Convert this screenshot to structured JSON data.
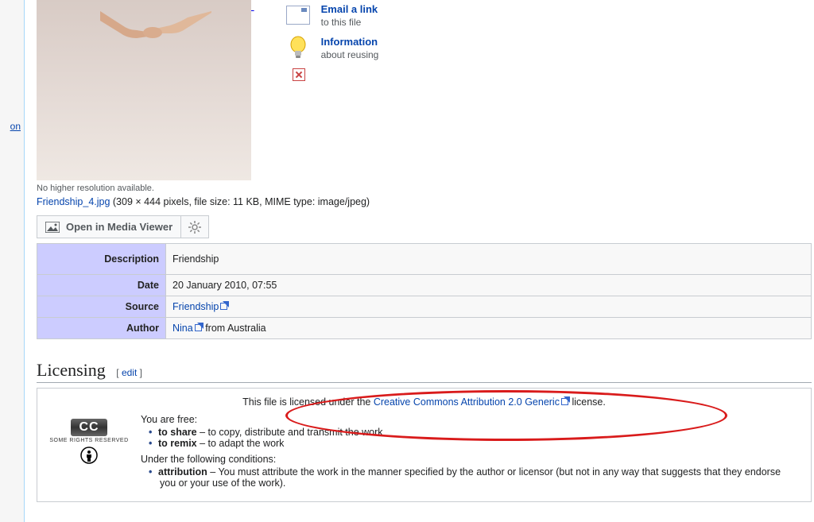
{
  "sidebar": {
    "truncated_link": "on"
  },
  "actions": {
    "email_label": "Email a link",
    "email_sub": "to this file",
    "info_label": "Information",
    "info_sub": "about reusing"
  },
  "file": {
    "no_higher": "No higher resolution available.",
    "filename": "Friendship_4.jpg",
    "details": " (309 × 444 pixels, file size: 11 KB, MIME type: image/jpeg)",
    "open_mv": "Open in Media Viewer"
  },
  "info_table": {
    "desc_label": "Description",
    "desc_value": "Friendship",
    "date_label": "Date",
    "date_value": "20 January 2010, 07:55",
    "source_label": "Source",
    "source_link": "Friendship",
    "author_label": "Author",
    "author_link": "Nina",
    "author_rest": " from Australia"
  },
  "licensing": {
    "heading": "Licensing",
    "edit_open": "[ ",
    "edit_label": "edit",
    "edit_close": " ]",
    "statement_pre": "This file is licensed under the ",
    "statement_link": "Creative Commons Attribution 2.0 Generic",
    "statement_post": " license.",
    "cc_logo": "CC",
    "some_rights": "SOME RIGHTS RESERVED",
    "you_are_free": "You are free:",
    "share_b": "to share",
    "share_rest": " – to copy, distribute and transmit the work",
    "remix_b": "to remix",
    "remix_rest": " – to adapt the work",
    "under_cond": "Under the following conditions:",
    "attr_b": "attribution",
    "attr_rest": " – You must attribute the work in the manner specified by the author or licensor (but not in any way that suggests that they endorse you or your use of the work)."
  }
}
